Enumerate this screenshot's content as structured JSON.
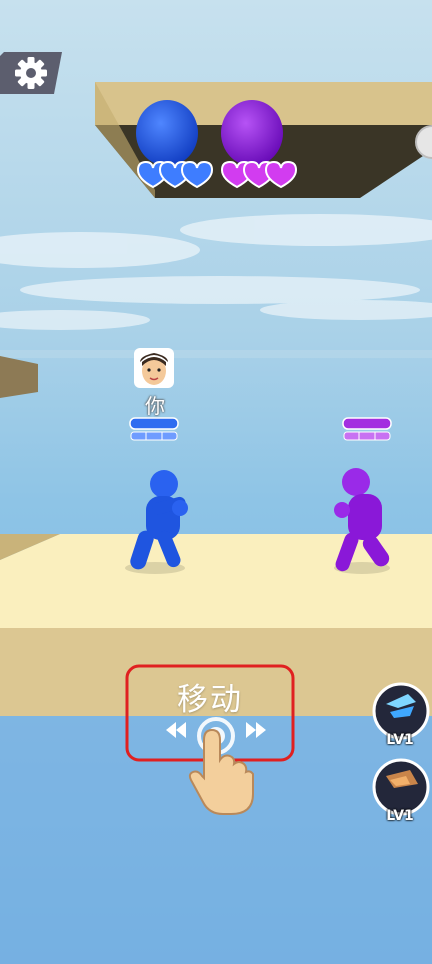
{
  "player": {
    "name": "你"
  },
  "hint": {
    "move_label": "移动"
  },
  "skills": [
    {
      "level": "LV1",
      "icon": "ice-shard-icon"
    },
    {
      "level": "LV1",
      "icon": "fire-rock-icon"
    }
  ],
  "colors": {
    "sky": "#9cc9e4",
    "platform": "#f6e6b0",
    "blue_team": "#1f55e0",
    "purple_team": "#8a18d8",
    "hint_frame": "#e02020"
  }
}
